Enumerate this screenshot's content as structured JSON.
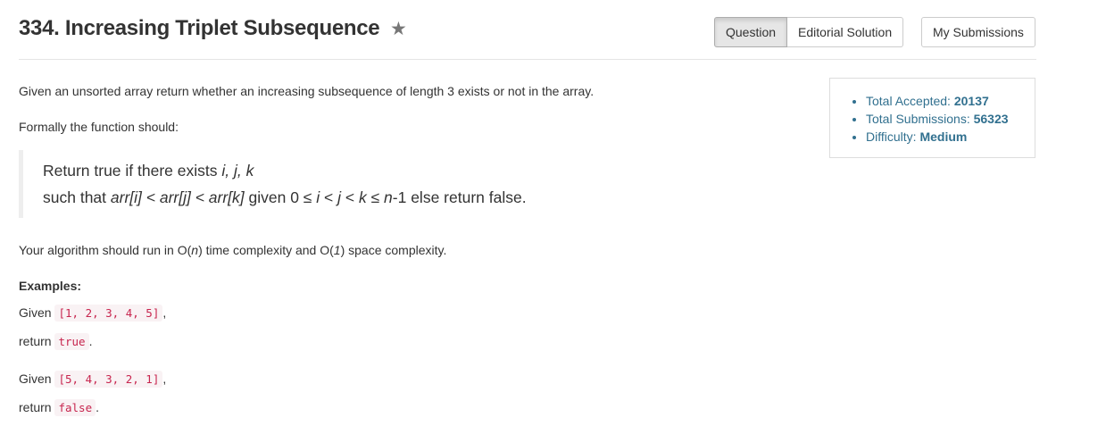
{
  "problem": {
    "title": "334. Increasing Triplet Subsequence",
    "star_icon": "star-icon"
  },
  "tabs": {
    "question": "Question",
    "editorial": "Editorial Solution",
    "submissions": "My Submissions"
  },
  "stats": {
    "accepted_label": "Total Accepted: ",
    "accepted_value": "20137",
    "submissions_label": "Total Submissions: ",
    "submissions_value": "56323",
    "difficulty_label": "Difficulty: ",
    "difficulty_value": "Medium"
  },
  "description": {
    "intro": "Given an unsorted array return whether an increasing subsequence of length 3 exists or not in the array.",
    "formally": "Formally the function should:",
    "quote_line1_prefix": "Return true if there exists ",
    "quote_line1_vars": "i, j, k",
    "quote_line2_a": "such that ",
    "quote_line2_expr": "arr[i] < arr[j] < arr[k]",
    "quote_line2_b": " given 0 ≤ ",
    "quote_line2_c": "i",
    "quote_line2_d": " < ",
    "quote_line2_e": "j",
    "quote_line2_f": " < ",
    "quote_line2_g": "k",
    "quote_line2_h": " ≤ ",
    "quote_line2_i": "n",
    "quote_line2_j": "-1 else return false.",
    "complexity_a": "Your algorithm should run in O(",
    "complexity_n": "n",
    "complexity_b": ") time complexity and O(",
    "complexity_one": "1",
    "complexity_c": ") space complexity."
  },
  "examples": {
    "heading": "Examples:",
    "ex1_given": "Given ",
    "ex1_input": "[1, 2, 3, 4, 5]",
    "ex1_return": "return ",
    "ex1_output": "true",
    "ex2_given": "Given ",
    "ex2_input": "[5, 4, 3, 2, 1]",
    "ex2_return": "return ",
    "ex2_output": "false",
    "comma": ",",
    "period": "."
  },
  "colors": {
    "accent_info": "#31708f",
    "code_text": "#c7254e",
    "code_bg": "#f9f2f4"
  }
}
